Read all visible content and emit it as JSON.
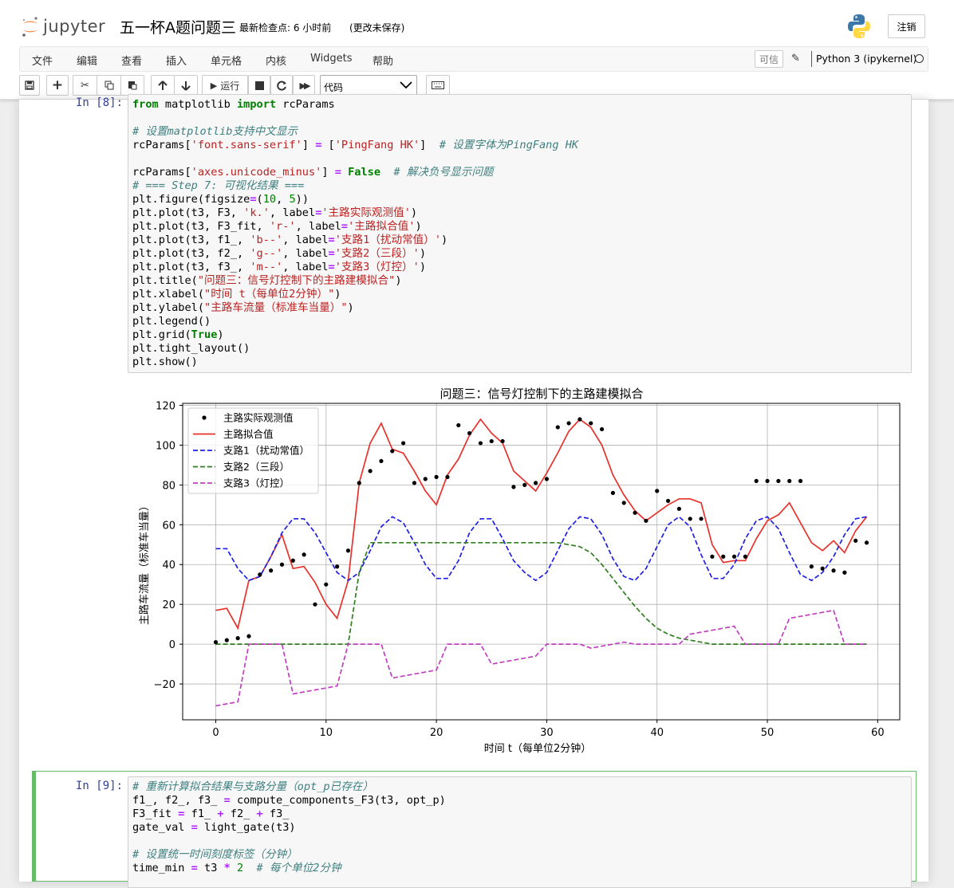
{
  "header": {
    "logo_text": "jupyter",
    "notebook_title": "五一杯A题问题三",
    "checkpoint": "最新检查点: 6 小时前",
    "autosave": "(更改未保存)",
    "logout_label": "注销"
  },
  "menubar": {
    "items": [
      "文件",
      "编辑",
      "查看",
      "插入",
      "单元格",
      "内核",
      "Widgets",
      "帮助"
    ],
    "trusted_label": "可信",
    "kernel_name": "Python 3 (ipykernel)"
  },
  "toolbar": {
    "run_label": "运行",
    "cell_type": "代码"
  },
  "cells": [
    {
      "prompt": "In [8]:",
      "lines": [
        "from matplotlib import rcParams",
        "",
        "# 设置matplotlib支持中文显示",
        "rcParams['font.sans-serif'] = ['PingFang HK']  # 设置字体为PingFang HK",
        "",
        "rcParams['axes.unicode_minus'] = False  # 解决负号显示问题",
        "# === Step 7: 可视化结果 ===",
        "plt.figure(figsize=(10, 5))",
        "plt.plot(t3, F3, 'k.', label='主路实际观测值')",
        "plt.plot(t3, F3_fit, 'r-', label='主路拟合值')",
        "plt.plot(t3, f1_, 'b--', label='支路1（扰动常值）')",
        "plt.plot(t3, f2_, 'g--', label='支路2（三段）')",
        "plt.plot(t3, f3_, 'm--', label='支路3（灯控）')",
        "plt.title(\"问题三：信号灯控制下的主路建模拟合\")",
        "plt.xlabel(\"时间 t（每单位2分钟）\")",
        "plt.ylabel(\"主路车流量（标准车当量）\")",
        "plt.legend()",
        "plt.grid(True)",
        "plt.tight_layout()",
        "plt.show()"
      ]
    },
    {
      "prompt": "In [9]:",
      "lines": [
        "# 重新计算拟合结果与支路分量（opt_p已存在）",
        "f1_, f2_, f3_ = compute_components_F3(t3, opt_p)",
        "F3_fit = f1_ + f2_ + f3_",
        "gate_val = light_gate(t3)",
        "",
        "# 设置统一时间刻度标签（分钟）",
        "time_min = t3 * 2  # 每个单位2分钟"
      ]
    }
  ],
  "chart_data": {
    "type": "line",
    "title": "问题三：信号灯控制下的主路建模拟合",
    "xlabel": "时间 t（每单位2分钟）",
    "ylabel": "主路车流量（标准车当量）",
    "xlim": [
      -3,
      62
    ],
    "ylim": [
      -38,
      121
    ],
    "xticks": [
      0,
      10,
      20,
      30,
      40,
      50,
      60
    ],
    "yticks": [
      -20,
      0,
      20,
      40,
      60,
      80,
      100,
      120
    ],
    "grid": true,
    "legend_position": "top-left",
    "x": [
      0,
      1,
      2,
      3,
      4,
      5,
      6,
      7,
      8,
      9,
      10,
      11,
      12,
      13,
      14,
      15,
      16,
      17,
      18,
      19,
      20,
      21,
      22,
      23,
      24,
      25,
      26,
      27,
      28,
      29,
      30,
      31,
      32,
      33,
      34,
      35,
      36,
      37,
      38,
      39,
      40,
      41,
      42,
      43,
      44,
      45,
      46,
      47,
      48,
      49,
      50,
      51,
      52,
      53,
      54,
      55,
      56,
      57,
      58,
      59
    ],
    "series": [
      {
        "name": "主路实际观测值",
        "style": "points",
        "color": "#000000",
        "values": [
          1,
          2,
          3,
          4,
          35,
          37,
          40,
          42,
          45,
          20,
          30,
          39,
          47,
          81,
          87,
          92,
          97,
          101,
          81,
          83,
          84,
          84,
          110,
          106,
          101,
          102,
          102,
          79,
          80,
          81,
          83,
          109,
          111,
          113,
          111,
          108,
          76,
          71,
          66,
          62,
          77,
          72,
          68,
          63,
          63,
          44,
          44,
          44,
          44,
          82,
          82,
          82,
          82,
          82,
          39,
          38,
          37,
          36,
          52,
          51
        ]
      },
      {
        "name": "主路拟合值",
        "style": "solid",
        "color": "#e8312a",
        "values": [
          17,
          18,
          8,
          32,
          34,
          44,
          55,
          38,
          39,
          31,
          20,
          13,
          32,
          81,
          101,
          111,
          98,
          96,
          87,
          77,
          70,
          85,
          93,
          105,
          113,
          106,
          101,
          87,
          82,
          77,
          86,
          96,
          107,
          113,
          109,
          100,
          85,
          75,
          67,
          62,
          66,
          70,
          73,
          73,
          71,
          50,
          41,
          42,
          42,
          53,
          62,
          65,
          71,
          61,
          51,
          47,
          52,
          46,
          57,
          64
        ]
      },
      {
        "name": "支路1（扰动常值）",
        "style": "dashed",
        "color": "#1f1fe6",
        "values": [
          48,
          48,
          38,
          32,
          34,
          44,
          56,
          63,
          63,
          56,
          46,
          36,
          32,
          36,
          47,
          59,
          64,
          61,
          51,
          40,
          33,
          33,
          42,
          56,
          63,
          63,
          53,
          42,
          36,
          32,
          36,
          47,
          58,
          64,
          63,
          55,
          43,
          34,
          32,
          38,
          49,
          60,
          64,
          59,
          45,
          33,
          33,
          40,
          53,
          62,
          64,
          58,
          46,
          35,
          32,
          36,
          44,
          55,
          63,
          64
        ]
      },
      {
        "name": "支路2（三段）",
        "style": "dashed",
        "color": "#2f7f1f",
        "values": [
          0,
          0,
          0,
          0,
          0,
          0,
          0,
          0,
          0,
          0,
          0,
          0,
          0,
          36,
          51,
          51,
          51,
          51,
          51,
          51,
          51,
          51,
          51,
          51,
          51,
          51,
          51,
          51,
          51,
          51,
          51,
          51,
          50,
          49,
          46,
          40,
          33,
          26,
          19,
          13,
          8,
          5,
          3,
          2,
          1,
          0,
          0,
          0,
          0,
          0,
          0,
          0,
          0,
          0,
          0,
          0,
          0,
          0,
          0,
          0
        ]
      },
      {
        "name": "支路3（灯控）",
        "style": "dashed",
        "color": "#c040c0",
        "values": [
          -31,
          -30,
          -29,
          0,
          0,
          0,
          0,
          -25,
          -24,
          -23,
          -22,
          -21,
          0,
          0,
          0,
          0,
          -17,
          -16,
          -15,
          -14,
          -13,
          0,
          0,
          0,
          0,
          -10,
          -9,
          -8,
          -7,
          -6,
          0,
          0,
          0,
          0,
          -2,
          -1,
          0,
          1,
          0,
          0,
          0,
          0,
          0,
          5,
          6,
          7,
          8,
          9,
          0,
          0,
          0,
          0,
          13,
          14,
          15,
          16,
          17,
          0,
          0,
          0
        ]
      }
    ]
  }
}
